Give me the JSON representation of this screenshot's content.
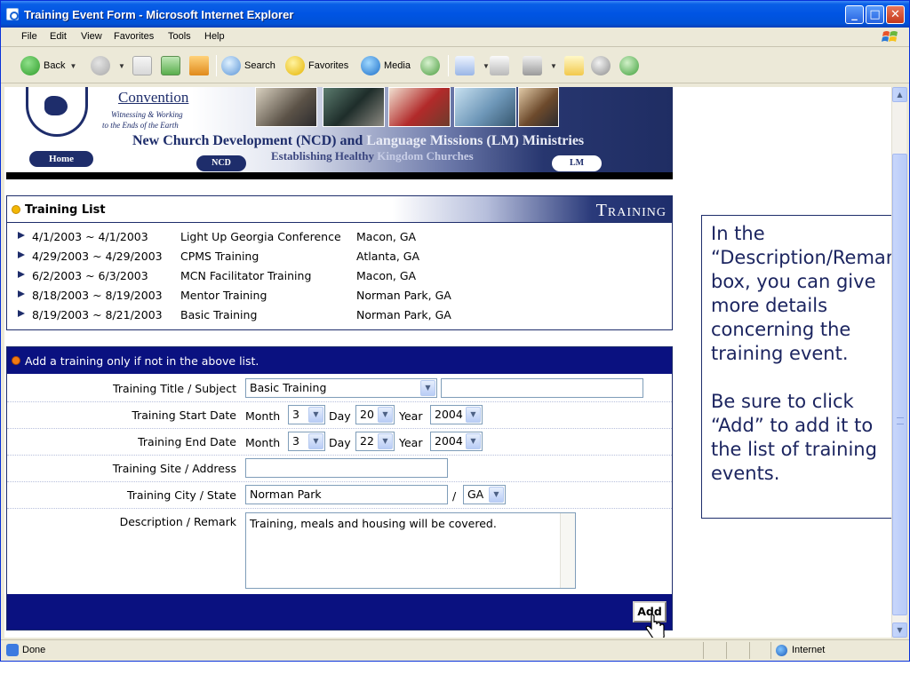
{
  "window": {
    "title": "Training Event Form - Microsoft Internet Explorer"
  },
  "menu": [
    "File",
    "Edit",
    "View",
    "Favorites",
    "Tools",
    "Help"
  ],
  "toolbar": {
    "back": "Back",
    "search": "Search",
    "favorites": "Favorites",
    "media": "Media"
  },
  "banner": {
    "convention": "Convention",
    "subtitle1": "Witnessing & Working",
    "subtitle2": "to the Ends of the Earth",
    "title_ncd": "New Church Development (NCD) and",
    "title_lm": "Language Missions (LM) Ministries",
    "tagline_a": "Establishing Healthy",
    "tagline_b": "Kingdom Churches",
    "home": "Home",
    "ncd": "NCD",
    "lm": "LM"
  },
  "training_list": {
    "title": "Training List",
    "section": "Training",
    "rows": [
      {
        "date": "4/1/2003 ~ 4/1/2003",
        "event": "Light Up Georgia Conference",
        "location": "Macon, GA"
      },
      {
        "date": "4/29/2003 ~ 4/29/2003",
        "event": "CPMS Training",
        "location": "Atlanta, GA"
      },
      {
        "date": "6/2/2003 ~ 6/3/2003",
        "event": "MCN Facilitator Training",
        "location": "Macon, GA"
      },
      {
        "date": "8/18/2003 ~ 8/19/2003",
        "event": "Mentor Training",
        "location": "Norman Park, GA"
      },
      {
        "date": "8/19/2003 ~ 8/21/2003",
        "event": "Basic Training",
        "location": "Norman Park, GA"
      }
    ]
  },
  "form": {
    "header": "Add a training only if not in the above list.",
    "title_label": "Training Title / Subject",
    "title_select": "Basic Training",
    "title_other": "",
    "start_label": "Training Start Date",
    "end_label": "Training End Date",
    "month_label": "Month",
    "day_label": "Day",
    "year_label": "Year",
    "start": {
      "month": "3",
      "day": "20",
      "year": "2004"
    },
    "end": {
      "month": "3",
      "day": "22",
      "year": "2004"
    },
    "site_label": "Training Site / Address",
    "site_value": "",
    "city_label": "Training City / State",
    "city_value": "Norman Park",
    "slash": "/",
    "state_value": "GA",
    "desc_label": "Description / Remark",
    "desc_value": "Training, meals and housing will be covered.",
    "add_button": "Add"
  },
  "callout": {
    "para1": "In the “Description/Remark” box, you can give more details concerning the training event.",
    "para2": "Be sure to click “Add” to add it to the list of training events."
  },
  "status": {
    "text": "Done",
    "zone": "Internet"
  }
}
